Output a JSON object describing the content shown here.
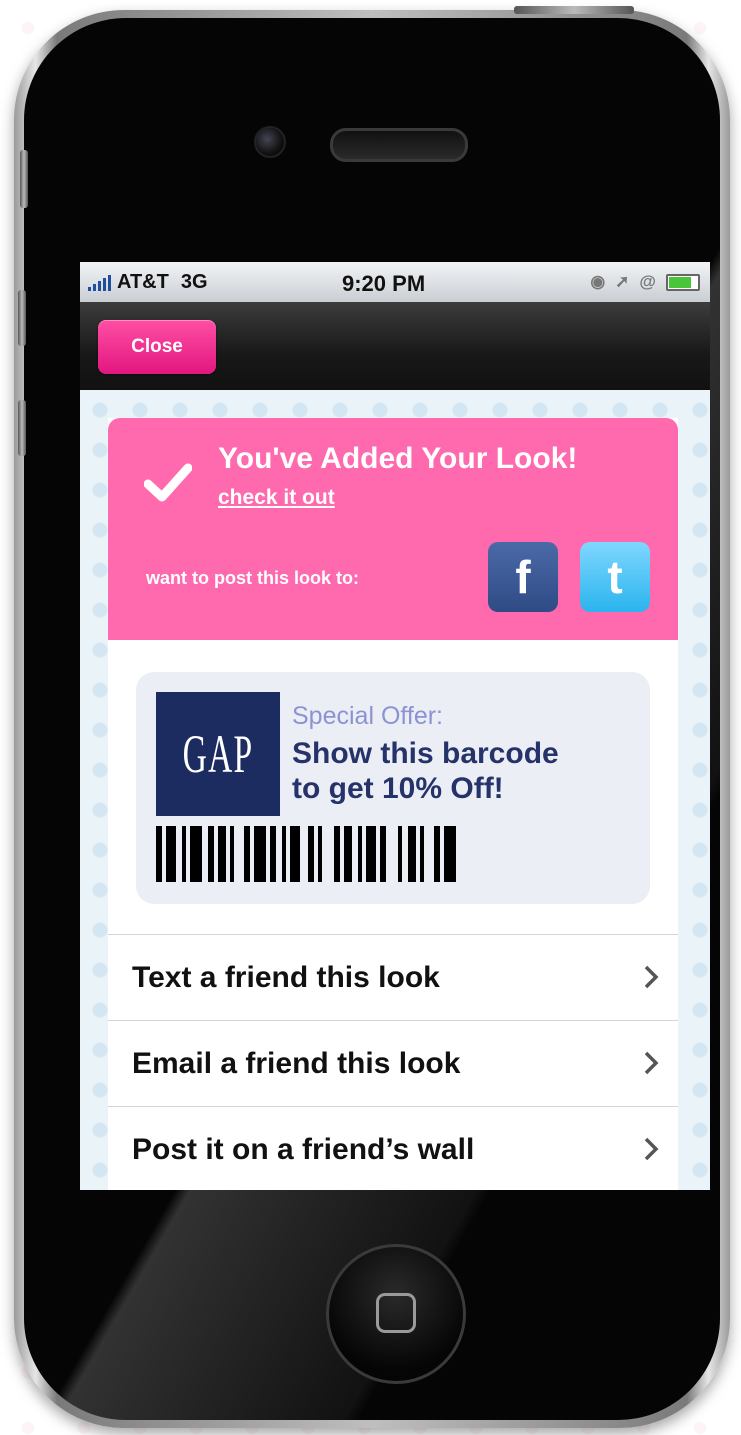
{
  "status_bar": {
    "carrier": "AT&T",
    "network": "3G",
    "time": "9:20 PM"
  },
  "navbar": {
    "close_label": "Close"
  },
  "confirmation": {
    "title": "You've Added Your Look!",
    "link": "check it out",
    "share_prompt": "want to post this look to:",
    "social": [
      {
        "icon": "facebook-icon",
        "glyph": "f",
        "color": "#3b5998"
      },
      {
        "icon": "twitter-icon",
        "glyph": "t",
        "color": "#2bb4ee"
      }
    ]
  },
  "offer": {
    "brand_logo_text": "GAP",
    "label": "Special Offer:",
    "text_line1": "Show this barcode",
    "text_line2": "to get 10% Off!"
  },
  "menu": {
    "items": [
      {
        "label": "Text a friend this look"
      },
      {
        "label": "Email a friend this look"
      },
      {
        "label": "Post it on a friend’s wall"
      }
    ]
  },
  "colors": {
    "accent_pink": "#ff69ad",
    "button_pink": "#e2167f",
    "gap_navy": "#1c2c61",
    "offer_text": "#26336a"
  }
}
